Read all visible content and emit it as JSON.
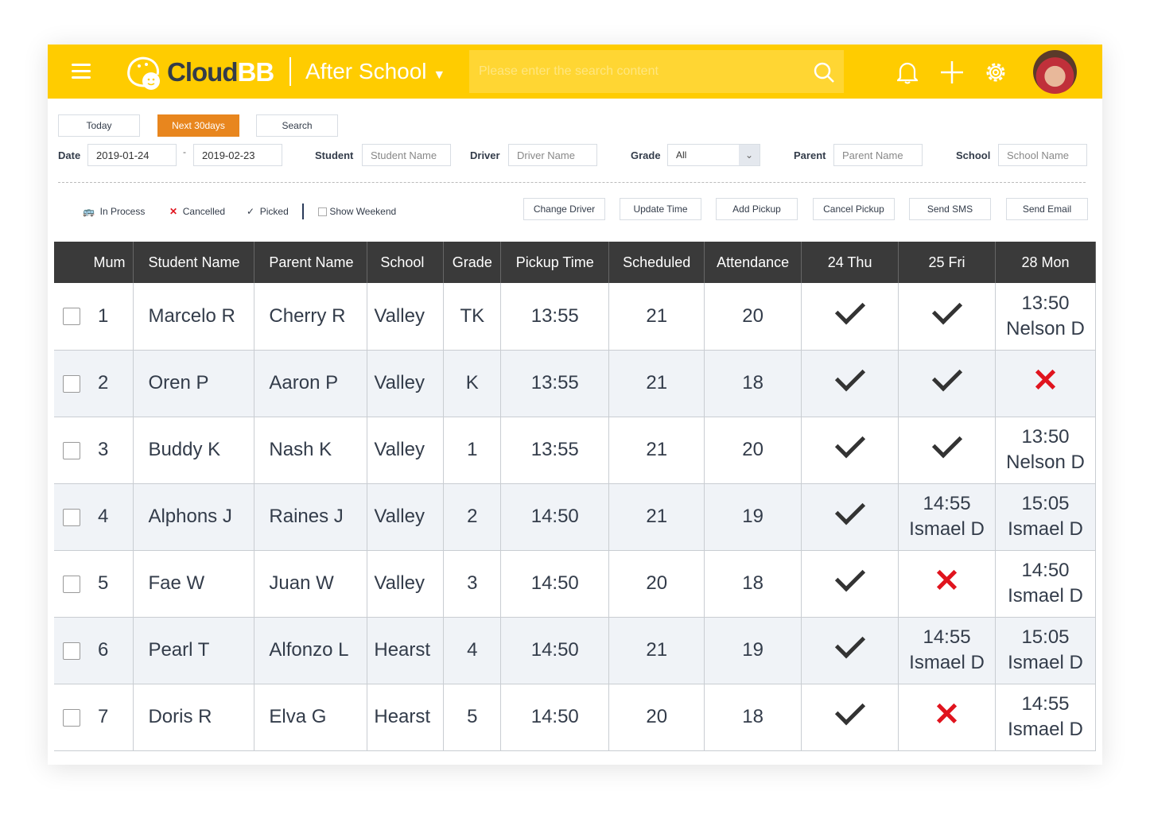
{
  "header": {
    "logo_dark": "Cloud",
    "logo_light": "BB",
    "app_name": "After School",
    "search_placeholder": "Please enter the search content"
  },
  "filters": {
    "today": "Today",
    "next30": "Next 30days",
    "search": "Search",
    "date_label": "Date",
    "date_from": "2019-01-24",
    "date_sep": "-",
    "date_to": "2019-02-23",
    "student_label": "Student",
    "student_placeholder": "Student Name",
    "driver_label": "Driver",
    "driver_placeholder": "Driver Name",
    "grade_label": "Grade",
    "grade_value": "All",
    "parent_label": "Parent",
    "parent_placeholder": "Parent Name",
    "school_label": "School",
    "school_placeholder": "School Name"
  },
  "legend": {
    "in_process": "In Process",
    "cancelled": "Cancelled",
    "picked": "Picked",
    "show_weekend": "Show Weekend"
  },
  "actions": [
    "Change Driver",
    "Update Time",
    "Add Pickup",
    "Cancel Pickup",
    "Send SMS",
    "Send Email"
  ],
  "columns": [
    "Mum",
    "Student Name",
    "Parent Name",
    "School",
    "Grade",
    "Pickup Time",
    "Scheduled",
    "Attendance",
    "24 Thu",
    "25 Fri",
    "28 Mon"
  ],
  "rows": [
    {
      "num": "1",
      "student": "Marcelo R",
      "parent": "Cherry R",
      "school": "Valley",
      "grade": "TK",
      "time": "13:55",
      "scheduled": "21",
      "attendance": "20",
      "days": [
        {
          "type": "check"
        },
        {
          "type": "check"
        },
        {
          "type": "time",
          "time": "13:50",
          "driver": "Nelson D"
        }
      ]
    },
    {
      "num": "2",
      "student": "Oren P",
      "parent": "Aaron P",
      "school": "Valley",
      "grade": "K",
      "time": "13:55",
      "scheduled": "21",
      "attendance": "18",
      "days": [
        {
          "type": "check"
        },
        {
          "type": "check"
        },
        {
          "type": "cross"
        }
      ]
    },
    {
      "num": "3",
      "student": "Buddy K",
      "parent": "Nash K",
      "school": "Valley",
      "grade": "1",
      "time": "13:55",
      "scheduled": "21",
      "attendance": "20",
      "days": [
        {
          "type": "check"
        },
        {
          "type": "check"
        },
        {
          "type": "time",
          "time": "13:50",
          "driver": "Nelson D"
        }
      ]
    },
    {
      "num": "4",
      "student": "Alphons J",
      "parent": "Raines J",
      "school": "Valley",
      "grade": "2",
      "time": "14:50",
      "scheduled": "21",
      "attendance": "19",
      "days": [
        {
          "type": "check"
        },
        {
          "type": "time",
          "time": "14:55",
          "driver": "Ismael D"
        },
        {
          "type": "time",
          "time": "15:05",
          "driver": "Ismael D"
        }
      ]
    },
    {
      "num": "5",
      "student": "Fae W",
      "parent": "Juan W",
      "school": "Valley",
      "grade": "3",
      "time": "14:50",
      "scheduled": "20",
      "attendance": "18",
      "days": [
        {
          "type": "check"
        },
        {
          "type": "cross"
        },
        {
          "type": "time",
          "time": "14:50",
          "driver": "Ismael D"
        }
      ]
    },
    {
      "num": "6",
      "student": "Pearl T",
      "parent": "Alfonzo L",
      "school": "Hearst",
      "grade": "4",
      "time": "14:50",
      "scheduled": "21",
      "attendance": "19",
      "days": [
        {
          "type": "check"
        },
        {
          "type": "time",
          "time": "14:55",
          "driver": "Ismael D"
        },
        {
          "type": "time",
          "time": "15:05",
          "driver": "Ismael D"
        }
      ]
    },
    {
      "num": "7",
      "student": "Doris R",
      "parent": "Elva G",
      "school": "Hearst",
      "grade": "5",
      "time": "14:50",
      "scheduled": "20",
      "attendance": "18",
      "days": [
        {
          "type": "check"
        },
        {
          "type": "cross"
        },
        {
          "type": "time",
          "time": "14:55",
          "driver": "Ismael D"
        }
      ]
    }
  ],
  "colors": {
    "brand": "#ffcc00",
    "accent": "#e8861e",
    "cancel": "#e0141e",
    "header_bg": "#3a3a3a"
  }
}
